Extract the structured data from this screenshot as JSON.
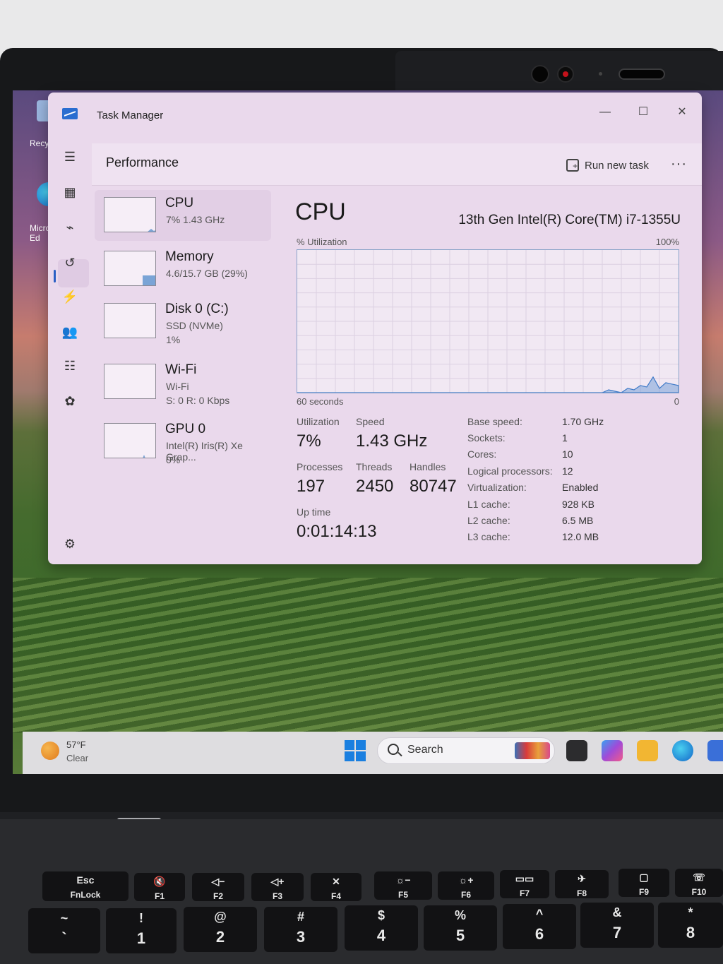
{
  "desktop": {
    "icons": [
      {
        "label": "Recyc",
        "name": "recycle-bin"
      },
      {
        "label": "Micro Ed",
        "name": "edge-shortcut"
      }
    ]
  },
  "taskbar": {
    "weather_temp": "57°F",
    "weather_cond": "Clear",
    "search_label": "Search"
  },
  "window": {
    "title": "Task Manager",
    "minimize": "—",
    "maximize": "☐",
    "close": "✕"
  },
  "header": {
    "page_title": "Performance",
    "run_new_task": "Run new task",
    "more": "···"
  },
  "nav": [
    {
      "name": "hamburger-menu-icon",
      "glyph": "☰"
    },
    {
      "name": "processes-icon",
      "glyph": "▦"
    },
    {
      "name": "performance-icon",
      "glyph": "⌁"
    },
    {
      "name": "app-history-icon",
      "glyph": "↺"
    },
    {
      "name": "startup-apps-icon",
      "glyph": "⚡"
    },
    {
      "name": "users-icon",
      "glyph": "👥"
    },
    {
      "name": "details-icon",
      "glyph": "☷"
    },
    {
      "name": "services-icon",
      "glyph": "✿"
    },
    {
      "name": "settings-icon",
      "glyph": "⚙"
    }
  ],
  "resources": [
    {
      "name": "CPU",
      "sub1": "7%  1.43 GHz",
      "sub2": ""
    },
    {
      "name": "Memory",
      "sub1": "4.6/15.7 GB (29%)",
      "sub2": ""
    },
    {
      "name": "Disk 0 (C:)",
      "sub1": "SSD (NVMe)",
      "sub2": "1%"
    },
    {
      "name": "Wi-Fi",
      "sub1": "Wi-Fi",
      "sub2": "S: 0  R: 0 Kbps"
    },
    {
      "name": "GPU 0",
      "sub1": "Intel(R) Iris(R) Xe Grap...",
      "sub2": "0%"
    }
  ],
  "cpu": {
    "heading": "CPU",
    "model": "13th Gen Intel(R) Core(TM) i7-1355U",
    "axis_top_left": "% Utilization",
    "axis_top_right": "100%",
    "axis_bot_left": "60 seconds",
    "axis_bot_right": "0",
    "utilization_label": "Utilization",
    "utilization": "7%",
    "speed_label": "Speed",
    "speed": "1.43 GHz",
    "processes_label": "Processes",
    "processes": "197",
    "threads_label": "Threads",
    "threads": "2450",
    "handles_label": "Handles",
    "handles": "80747",
    "uptime_label": "Up time",
    "uptime": "0:01:14:13",
    "specs": [
      {
        "label": "Base speed:",
        "value": "1.70 GHz"
      },
      {
        "label": "Sockets:",
        "value": "1"
      },
      {
        "label": "Cores:",
        "value": "10"
      },
      {
        "label": "Logical processors:",
        "value": "12"
      },
      {
        "label": "Virtualization:",
        "value": "Enabled"
      },
      {
        "label": "L1 cache:",
        "value": "928 KB"
      },
      {
        "label": "L2 cache:",
        "value": "6.5 MB"
      },
      {
        "label": "L3 cache:",
        "value": "12.0 MB"
      }
    ],
    "utilization_history": [
      0,
      0,
      0,
      0,
      0,
      0,
      0,
      0,
      0,
      0,
      0,
      0,
      0,
      0,
      0,
      0,
      0,
      0,
      0,
      0,
      0,
      0,
      0,
      0,
      0,
      0,
      0,
      0,
      0,
      0,
      0,
      0,
      0,
      0,
      0,
      0,
      0,
      0,
      0,
      0,
      0,
      0,
      0,
      0,
      0,
      0,
      0,
      0,
      0,
      2,
      1,
      0,
      3,
      2,
      5,
      4,
      11,
      3,
      7,
      6,
      5
    ]
  },
  "keyboard": {
    "fn_row": [
      {
        "top": "Esc",
        "bottom": "FnLock"
      },
      {
        "top": "🔇",
        "bottom": "F1"
      },
      {
        "top": "◁−",
        "bottom": "F2"
      },
      {
        "top": "◁+",
        "bottom": "F3"
      },
      {
        "top": "✕",
        "bottom": "F4"
      },
      {
        "top": "☼−",
        "bottom": "F5"
      },
      {
        "top": "☼+",
        "bottom": "F6"
      },
      {
        "top": "▭▭",
        "bottom": "F7"
      },
      {
        "top": "✈",
        "bottom": "F8"
      },
      {
        "top": "▢",
        "bottom": "F9"
      },
      {
        "top": "☏",
        "bottom": "F10"
      }
    ],
    "num_row": [
      {
        "top": "~",
        "bottom": "`"
      },
      {
        "top": "!",
        "bottom": "1"
      },
      {
        "top": "@",
        "bottom": "2"
      },
      {
        "top": "#",
        "bottom": "3"
      },
      {
        "top": "$",
        "bottom": "4"
      },
      {
        "top": "%",
        "bottom": "5"
      },
      {
        "top": "^",
        "bottom": "6"
      },
      {
        "top": "&",
        "bottom": "7"
      },
      {
        "top": "*",
        "bottom": "8"
      }
    ]
  }
}
